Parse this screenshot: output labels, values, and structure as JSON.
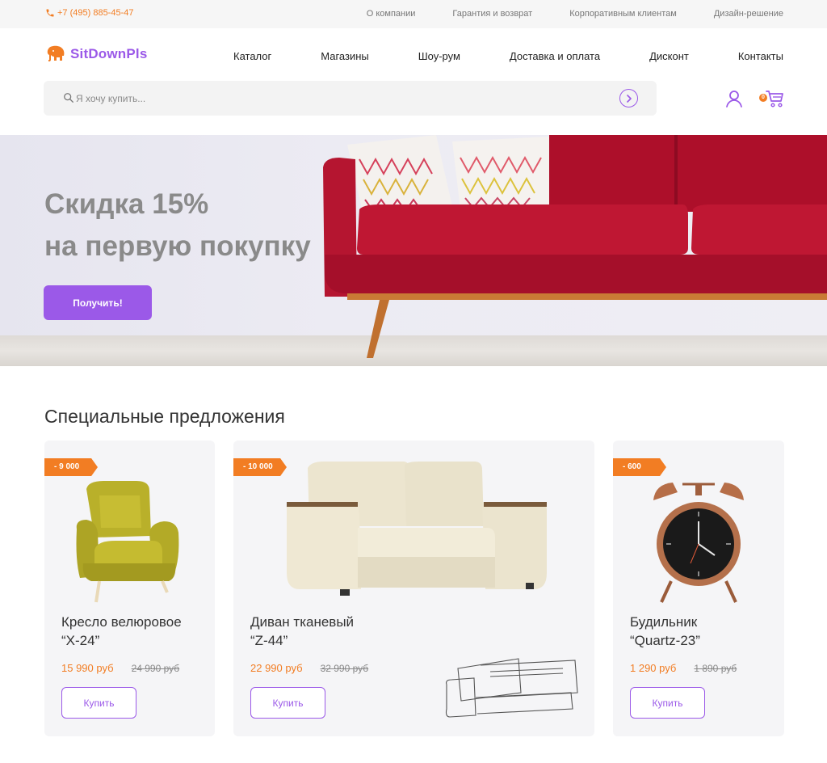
{
  "topbar": {
    "phone": "+7 (495) 885-45-47",
    "links": [
      "О компании",
      "Гарантия и возврат",
      "Корпоративным клиентам",
      "Дизайн-решение"
    ]
  },
  "header": {
    "logo_text": "SitDownPls",
    "nav": [
      "Каталог",
      "Магазины",
      "Шоу-рум",
      "Доставка и оплата",
      "Дисконт",
      "Контакты"
    ],
    "cart_count": "0"
  },
  "search": {
    "placeholder": "Я хочу купить...",
    "value": ""
  },
  "hero": {
    "title_line1": "Скидка 15%",
    "title_line2": "на первую покупку",
    "button": "Получить!"
  },
  "specials": {
    "title": "Специальные предложения",
    "items": [
      {
        "badge": "- 9 000",
        "name_line1": "Кресло велюровое",
        "name_line2": "“X-24”",
        "price": "15 990 руб",
        "old_price": "24 990 руб",
        "button": "Купить"
      },
      {
        "badge": "- 10 000",
        "name_line1": "Диван тканевый",
        "name_line2": "“Z-44”",
        "price": "22 990 руб",
        "old_price": "32 990 руб",
        "button": "Купить"
      },
      {
        "badge": "- 600",
        "name_line1": "Будильник",
        "name_line2": "“Quartz-23”",
        "price": "1 290 руб",
        "old_price": "1 890 руб",
        "button": "Купить"
      }
    ]
  },
  "colors": {
    "accent": "#9b59e8",
    "orange": "#f27d23",
    "sofa_red": "#b5112c"
  },
  "icons": [
    "phone-icon",
    "elephant-logo-icon",
    "search-icon",
    "arrow-right-icon",
    "user-icon",
    "cart-icon"
  ]
}
